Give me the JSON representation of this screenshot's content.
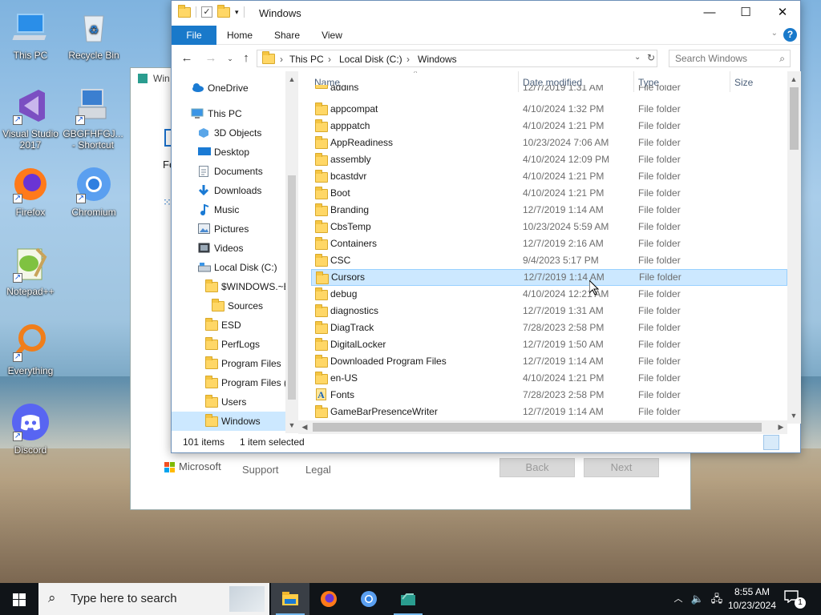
{
  "desktop": {
    "icons": [
      {
        "label": "This PC"
      },
      {
        "label": "Recycle Bin"
      },
      {
        "label": "Visual Studio 2017"
      },
      {
        "label": "GBGFHFGJ... - Shortcut"
      },
      {
        "label": "Firefox"
      },
      {
        "label": "Chromium"
      },
      {
        "label": "Notepad++"
      },
      {
        "label": "Everything"
      },
      {
        "label": "Discord"
      }
    ]
  },
  "setup_window": {
    "title": "Win",
    "partial_text": "Fe",
    "footer": {
      "brand": "Microsoft",
      "support": "Support",
      "legal": "Legal",
      "back": "Back",
      "next": "Next"
    }
  },
  "explorer": {
    "title": "Windows",
    "window_controls": {
      "minimize": "—",
      "maximize": "☐",
      "close": "✕"
    },
    "ribbon_tabs": [
      "File",
      "Home",
      "Share",
      "View"
    ],
    "help": "?",
    "address": {
      "crumbs": [
        "This PC",
        "Local Disk (C:)",
        "Windows"
      ],
      "sep": "›"
    },
    "search": {
      "placeholder": "Search Windows"
    },
    "nav_items": [
      {
        "label": "OneDrive",
        "icon": "cloud-icon"
      },
      {
        "label": "This PC",
        "icon": "pc-icon"
      },
      {
        "label": "3D Objects",
        "icon": "cube-icon"
      },
      {
        "label": "Desktop",
        "icon": "desktop-icon"
      },
      {
        "label": "Documents",
        "icon": "document-icon"
      },
      {
        "label": "Downloads",
        "icon": "download-icon"
      },
      {
        "label": "Music",
        "icon": "music-icon"
      },
      {
        "label": "Pictures",
        "icon": "pictures-icon"
      },
      {
        "label": "Videos",
        "icon": "video-icon"
      },
      {
        "label": "Local Disk (C:)",
        "icon": "drive-icon"
      },
      {
        "label": "$WINDOWS.~BT",
        "icon": "folder-icon"
      },
      {
        "label": "Sources",
        "icon": "folder-icon"
      },
      {
        "label": "ESD",
        "icon": "folder-icon"
      },
      {
        "label": "PerfLogs",
        "icon": "folder-icon"
      },
      {
        "label": "Program Files",
        "icon": "folder-icon"
      },
      {
        "label": "Program Files (x86)",
        "icon": "folder-icon"
      },
      {
        "label": "Users",
        "icon": "folder-icon"
      },
      {
        "label": "Windows",
        "icon": "folder-icon"
      }
    ],
    "columns": {
      "name": "Name",
      "date": "Date modified",
      "type": "Type",
      "size": "Size"
    },
    "partial_row": {
      "name": "addins",
      "date": "12/7/2019 1:31 AM",
      "type": "File folder"
    },
    "files": [
      {
        "name": "appcompat",
        "date": "4/10/2024 1:32 PM",
        "type": "File folder"
      },
      {
        "name": "apppatch",
        "date": "4/10/2024 1:21 PM",
        "type": "File folder"
      },
      {
        "name": "AppReadiness",
        "date": "10/23/2024 7:06 AM",
        "type": "File folder"
      },
      {
        "name": "assembly",
        "date": "4/10/2024 12:09 PM",
        "type": "File folder"
      },
      {
        "name": "bcastdvr",
        "date": "4/10/2024 1:21 PM",
        "type": "File folder"
      },
      {
        "name": "Boot",
        "date": "4/10/2024 1:21 PM",
        "type": "File folder"
      },
      {
        "name": "Branding",
        "date": "12/7/2019 1:14 AM",
        "type": "File folder"
      },
      {
        "name": "CbsTemp",
        "date": "10/23/2024 5:59 AM",
        "type": "File folder"
      },
      {
        "name": "Containers",
        "date": "12/7/2019 2:16 AM",
        "type": "File folder"
      },
      {
        "name": "CSC",
        "date": "9/4/2023 5:17 PM",
        "type": "File folder"
      },
      {
        "name": "Cursors",
        "date": "12/7/2019 1:14 AM",
        "type": "File folder",
        "selected": true
      },
      {
        "name": "debug",
        "date": "4/10/2024 12:21 AM",
        "type": "File folder"
      },
      {
        "name": "diagnostics",
        "date": "12/7/2019 1:31 AM",
        "type": "File folder"
      },
      {
        "name": "DiagTrack",
        "date": "7/28/2023 2:58 PM",
        "type": "File folder"
      },
      {
        "name": "DigitalLocker",
        "date": "12/7/2019 1:50 AM",
        "type": "File folder"
      },
      {
        "name": "Downloaded Program Files",
        "date": "12/7/2019 1:14 AM",
        "type": "File folder"
      },
      {
        "name": "en-US",
        "date": "4/10/2024 1:21 PM",
        "type": "File folder"
      },
      {
        "name": "Fonts",
        "date": "7/28/2023 2:58 PM",
        "type": "File folder",
        "icon": "font-folder-icon"
      },
      {
        "name": "GameBarPresenceWriter",
        "date": "12/7/2019 1:14 AM",
        "type": "File folder"
      }
    ],
    "status": {
      "count": "101 items",
      "selection": "1 item selected"
    }
  },
  "taskbar": {
    "search_placeholder": "Type here to search",
    "time": "8:55 AM",
    "date": "10/23/2024",
    "notification_count": "1",
    "accent": "#76b9ed"
  }
}
